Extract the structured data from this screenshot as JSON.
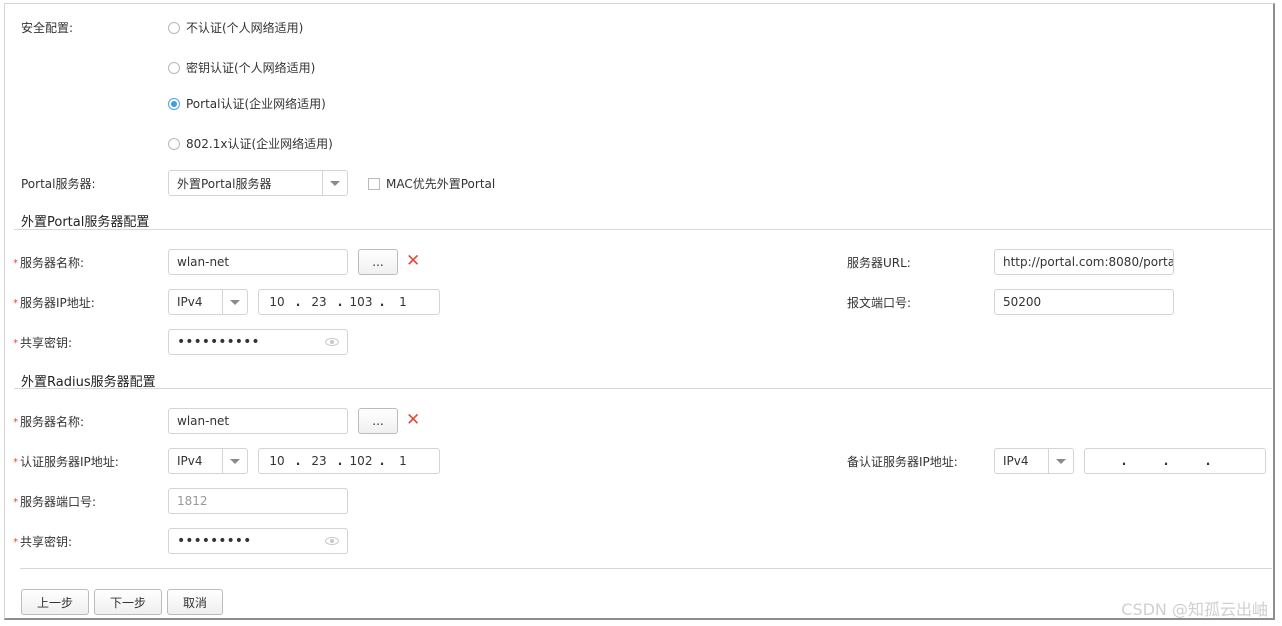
{
  "security": {
    "label": "安全配置:",
    "options": [
      {
        "label": "不认证(个人网络适用)",
        "checked": false
      },
      {
        "label": "密钥认证(个人网络适用)",
        "checked": false
      },
      {
        "label": "Portal认证(企业网络适用)",
        "checked": true
      },
      {
        "label": "802.1x认证(企业网络适用)",
        "checked": false
      }
    ]
  },
  "portal_server": {
    "label": "Portal服务器:",
    "value": "外置Portal服务器",
    "mac_checkbox_label": "MAC优先外置Portal",
    "mac_checked": false
  },
  "portal_config": {
    "title": "外置Portal服务器配置",
    "server_name_label": "服务器名称:",
    "server_name": "wlan-net",
    "browse_label": "...",
    "ip_label": "服务器IP地址:",
    "ip_type": "IPv4",
    "ip": [
      "10",
      "23",
      "103",
      "1"
    ],
    "key_label": "共享密钥:",
    "key_mask": "••••••••••",
    "url_label": "服务器URL:",
    "url": "http://portal.com:8080/porta",
    "port_label": "报文端口号:",
    "port": "50200"
  },
  "radius_config": {
    "title": "外置Radius服务器配置",
    "server_name_label": "服务器名称:",
    "server_name": "wlan-net",
    "browse_label": "...",
    "ip_label": "认证服务器IP地址:",
    "ip_type": "IPv4",
    "ip": [
      "10",
      "23",
      "102",
      "1"
    ],
    "backup_ip_label": "备认证服务器IP地址:",
    "backup_ip_type": "IPv4",
    "backup_ip": [
      "",
      "",
      "",
      ""
    ],
    "port_label": "服务器端口号:",
    "port_placeholder": "1812",
    "key_label": "共享密钥:",
    "key_mask": "•••••••••"
  },
  "buttons": {
    "prev": "上一步",
    "next": "下一步",
    "cancel": "取消"
  },
  "required_mark": "*",
  "watermark": "CSDN @知孤云出岫"
}
